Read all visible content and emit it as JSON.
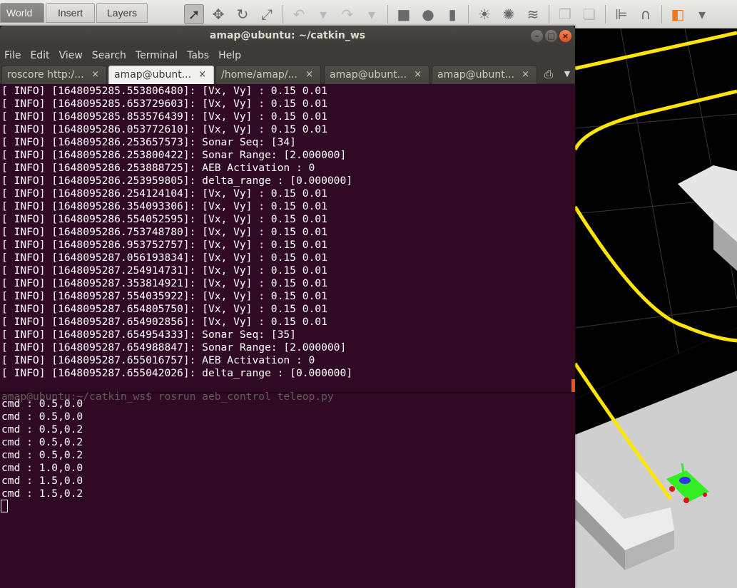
{
  "gazebo": {
    "tabs": [
      "World",
      "Insert",
      "Layers"
    ],
    "tools": [
      {
        "name": "select-arrow-icon",
        "glyph": "➚",
        "active": true
      },
      {
        "name": "translate-icon",
        "glyph": "✥"
      },
      {
        "name": "rotate-icon",
        "glyph": "↻"
      },
      {
        "name": "scale-icon",
        "glyph": "⤢"
      },
      {
        "sep": true
      },
      {
        "name": "undo-icon",
        "glyph": "↶",
        "light": true
      },
      {
        "name": "undo-dropdown-icon",
        "glyph": "▾",
        "light": true
      },
      {
        "name": "redo-icon",
        "glyph": "↷",
        "light": true
      },
      {
        "name": "redo-dropdown-icon",
        "glyph": "▾",
        "light": true
      },
      {
        "sep": true
      },
      {
        "name": "box-shape-icon",
        "glyph": "■"
      },
      {
        "name": "sphere-shape-icon",
        "glyph": "●"
      },
      {
        "name": "cylinder-shape-icon",
        "glyph": "▮"
      },
      {
        "sep": true
      },
      {
        "name": "point-light-icon",
        "glyph": "☀"
      },
      {
        "name": "spot-light-icon",
        "glyph": "✺"
      },
      {
        "name": "directional-light-icon",
        "glyph": "≋"
      },
      {
        "sep": true
      },
      {
        "name": "copy-icon",
        "glyph": "❐",
        "light": true
      },
      {
        "name": "paste-icon",
        "glyph": "❏",
        "light": true
      },
      {
        "sep": true
      },
      {
        "name": "align-icon",
        "glyph": "⊫"
      },
      {
        "name": "snap-icon",
        "glyph": "∩"
      },
      {
        "sep": true
      },
      {
        "name": "view-angle-icon",
        "glyph": "◧",
        "orange": true
      },
      {
        "name": "view-angle-dropdown-icon",
        "glyph": "▾"
      }
    ]
  },
  "terminal": {
    "title": "amap@ubuntu: ~/catkin_ws",
    "window_buttons": {
      "minimize": "–",
      "maximize": "□",
      "close": "×"
    },
    "menu": [
      "File",
      "Edit",
      "View",
      "Search",
      "Terminal",
      "Tabs",
      "Help"
    ],
    "tabs": [
      {
        "label": "roscore http:/...",
        "active": false
      },
      {
        "label": "amap@ubunt...",
        "active": true
      },
      {
        "label": "/home/amap/...",
        "active": false
      },
      {
        "label": "amap@ubunt...",
        "active": false
      },
      {
        "label": "amap@ubunt...",
        "active": false
      }
    ],
    "tab_close_glyph": "×",
    "new_tab_glyph": "⎙",
    "tab_menu_glyph": "▼",
    "log_lines": [
      "[ INFO] [1648095285.553806480]: [Vx, Vy] : 0.15 0.01",
      "[ INFO] [1648095285.653729603]: [Vx, Vy] : 0.15 0.01",
      "[ INFO] [1648095285.853576439]: [Vx, Vy] : 0.15 0.01",
      "[ INFO] [1648095286.053772610]: [Vx, Vy] : 0.15 0.01",
      "[ INFO] [1648095286.253657573]: Sonar Seq: [34]",
      "[ INFO] [1648095286.253800422]: Sonar Range: [2.000000]",
      "[ INFO] [1648095286.253888725]: AEB Activation : 0",
      "[ INFO] [1648095286.253959805]: delta_range : [0.000000]",
      "[ INFO] [1648095286.254124104]: [Vx, Vy] : 0.15 0.01",
      "[ INFO] [1648095286.354093306]: [Vx, Vy] : 0.15 0.01",
      "[ INFO] [1648095286.554052595]: [Vx, Vy] : 0.15 0.01",
      "[ INFO] [1648095286.753748780]: [Vx, Vy] : 0.15 0.01",
      "[ INFO] [1648095286.953752757]: [Vx, Vy] : 0.15 0.01",
      "[ INFO] [1648095287.056193834]: [Vx, Vy] : 0.15 0.01",
      "[ INFO] [1648095287.254914731]: [Vx, Vy] : 0.15 0.01",
      "[ INFO] [1648095287.353814921]: [Vx, Vy] : 0.15 0.01",
      "[ INFO] [1648095287.554035922]: [Vx, Vy] : 0.15 0.01",
      "[ INFO] [1648095287.654805750]: [Vx, Vy] : 0.15 0.01",
      "[ INFO] [1648095287.654902856]: [Vx, Vy] : 0.15 0.01",
      "[ INFO] [1648095287.654954333]: Sonar Seq: [35]",
      "[ INFO] [1648095287.654988847]: Sonar Range: [2.000000]",
      "[ INFO] [1648095287.655016757]: AEB Activation : 0",
      "[ INFO] [1648095287.655042026]: delta_range : [0.000000]"
    ],
    "prompt_line": "amap@ubuntu:~/catkin_ws$ rosrun aeb_control teleop.py",
    "cmd_lines": [
      "cmd : 0.5,0.0",
      "cmd : 0.5,0.0",
      "cmd : 0.5,0.2",
      "cmd : 0.5,0.2",
      "cmd : 0.5,0.2",
      "cmd : 1.0,0.0",
      "cmd : 1.5,0.0",
      "cmd : 1.5,0.2"
    ]
  },
  "colors": {
    "terminal_bg": "#300a24",
    "ubuntu_orange": "#e95420",
    "track_line": "#ffdd00"
  }
}
